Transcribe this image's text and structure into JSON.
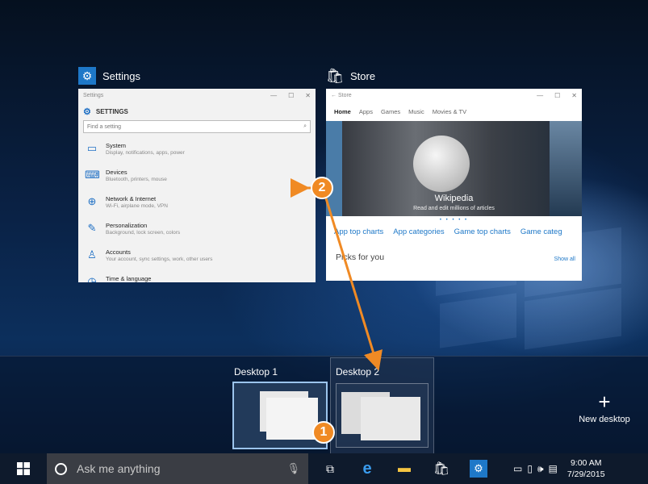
{
  "windows": {
    "settings": {
      "title": "Settings",
      "titlebar": "Settings",
      "heading": "SETTINGS",
      "search_placeholder": "Find a setting",
      "items": [
        {
          "title": "System",
          "subtitle": "Display, notifications, apps, power",
          "icon": "monitor-icon"
        },
        {
          "title": "Devices",
          "subtitle": "Bluetooth, printers, mouse",
          "icon": "keyboard-icon"
        },
        {
          "title": "Network & Internet",
          "subtitle": "Wi-Fi, airplane mode, VPN",
          "icon": "globe-icon"
        },
        {
          "title": "Personalization",
          "subtitle": "Background, lock screen, colors",
          "icon": "paint-icon"
        },
        {
          "title": "Accounts",
          "subtitle": "Your account, sync settings, work, other users",
          "icon": "person-icon"
        },
        {
          "title": "Time & language",
          "subtitle": "",
          "icon": "clock-icon"
        }
      ]
    },
    "store": {
      "title": "Store",
      "titlebar": "Store",
      "nav": [
        "Home",
        "Apps",
        "Games",
        "Music",
        "Movies & TV"
      ],
      "hero_title": "Wikipedia",
      "hero_subtitle": "Read and edit millions of articles",
      "links": [
        "App top charts",
        "App categories",
        "Game top charts",
        "Game categ"
      ],
      "picks": "Picks for you",
      "show_all": "Show all"
    }
  },
  "desktops": {
    "d1": "Desktop 1",
    "d2": "Desktop 2",
    "new_desktop": "New desktop"
  },
  "taskbar": {
    "search_placeholder": "Ask me anything",
    "time": "9:00 AM",
    "date": "7/29/2015"
  },
  "callouts": {
    "one": "1",
    "two": "2"
  },
  "colors": {
    "accent": "#1e78c8",
    "callout": "#f08a24"
  }
}
